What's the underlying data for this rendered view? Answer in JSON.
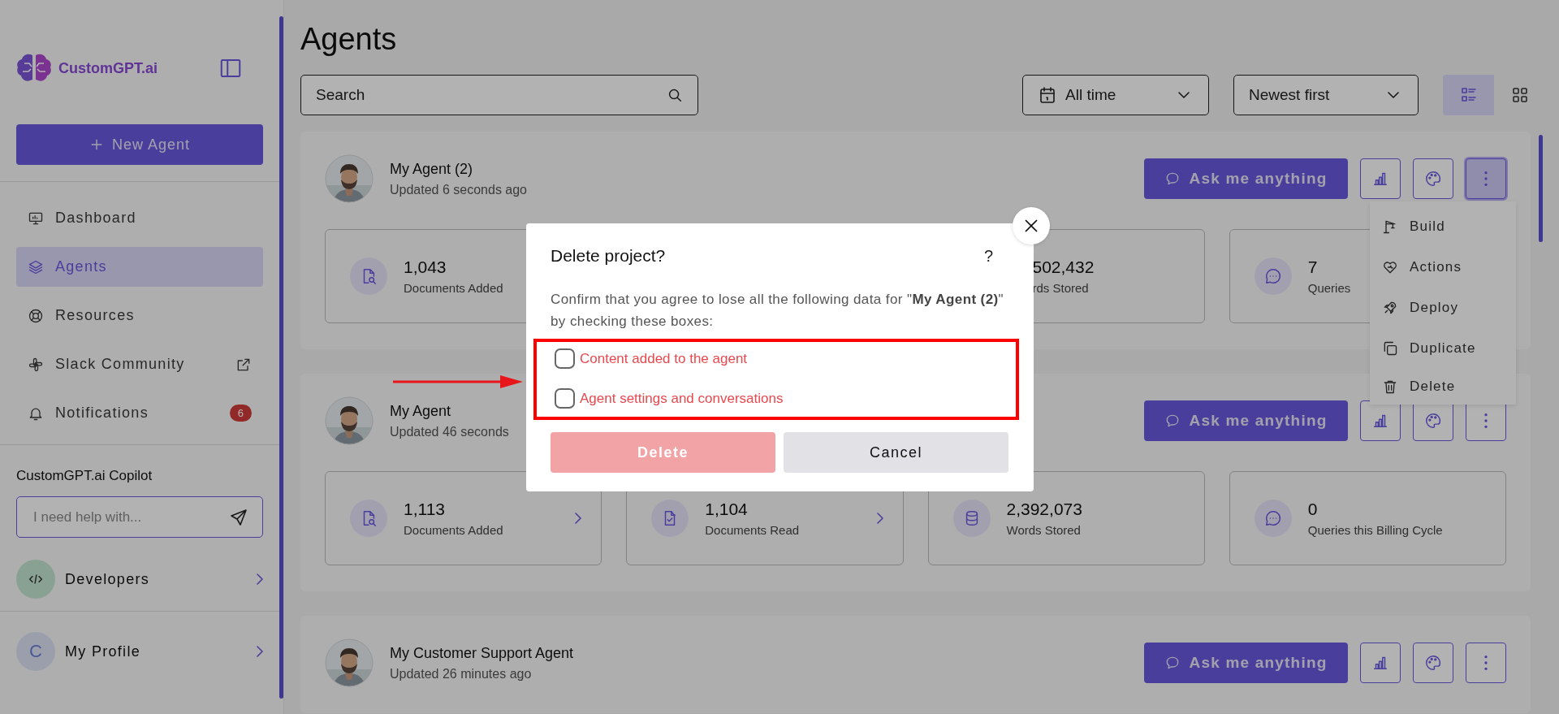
{
  "sidebar": {
    "logo": "CustomGPT.ai",
    "new_agent": "New Agent",
    "nav": [
      {
        "label": "Dashboard",
        "selected": false
      },
      {
        "label": "Agents",
        "selected": true
      },
      {
        "label": "Resources",
        "selected": false
      },
      {
        "label": "Slack Community",
        "selected": false,
        "external": true
      },
      {
        "label": "Notifications",
        "selected": false,
        "badge": "6"
      }
    ],
    "copilot": {
      "title": "CustomGPT.ai Copilot",
      "placeholder": "I need help with..."
    },
    "developers": {
      "label": "Developers"
    },
    "profile": {
      "initial": "C",
      "label": "My Profile"
    }
  },
  "header": {
    "title": "Agents",
    "search": {
      "placeholder": "Search"
    },
    "date_filter": "All time",
    "sort": "Newest first",
    "views": [
      {
        "kind": "list",
        "selected": true
      },
      {
        "kind": "grid",
        "selected": false
      }
    ]
  },
  "agents": [
    {
      "name": "My Agent (2)",
      "updated": "Updated 6 seconds ago",
      "ask": "Ask me anything",
      "menu_open": true,
      "stats": [
        {
          "kind": "full",
          "value": "1,043",
          "label": "Documents Added",
          "link": false
        },
        {
          "kind": "clipped",
          "value": "502,432",
          "label": "rds Stored"
        },
        {
          "kind": "full",
          "value": "7",
          "label": "Queries",
          "link": false
        }
      ]
    },
    {
      "name": "My Agent",
      "updated": "Updated 46 seconds",
      "ask": "Ask me anything",
      "menu_open": false,
      "stats": [
        {
          "kind": "full",
          "value": "1,113",
          "label": "Documents Added",
          "link": true
        },
        {
          "kind": "full",
          "value": "1,104",
          "label": "Documents Read",
          "link": true
        },
        {
          "kind": "full",
          "value": "2,392,073",
          "label": "Words Stored",
          "link": false
        },
        {
          "kind": "full",
          "value": "0",
          "label": "Queries this Billing Cycle",
          "link": false
        }
      ]
    },
    {
      "name": "My Customer Support Agent",
      "updated": "Updated 26 minutes ago",
      "ask": "Ask me anything",
      "menu_open": false
    }
  ],
  "menu": [
    "Build",
    "Actions",
    "Deploy",
    "Duplicate",
    "Delete"
  ],
  "dialog": {
    "title": "Delete project?",
    "help": "?",
    "text": "Confirm that you agree to lose all the following data for \"**My Agent (2)**\" by checking these boxes:",
    "options": [
      {
        "label": "Content added to the agent",
        "checked": false
      },
      {
        "label": "Agent settings and conversations",
        "checked": false
      }
    ],
    "delete": {
      "label": "Delete",
      "disabled": true
    },
    "cancel": "Cancel"
  }
}
